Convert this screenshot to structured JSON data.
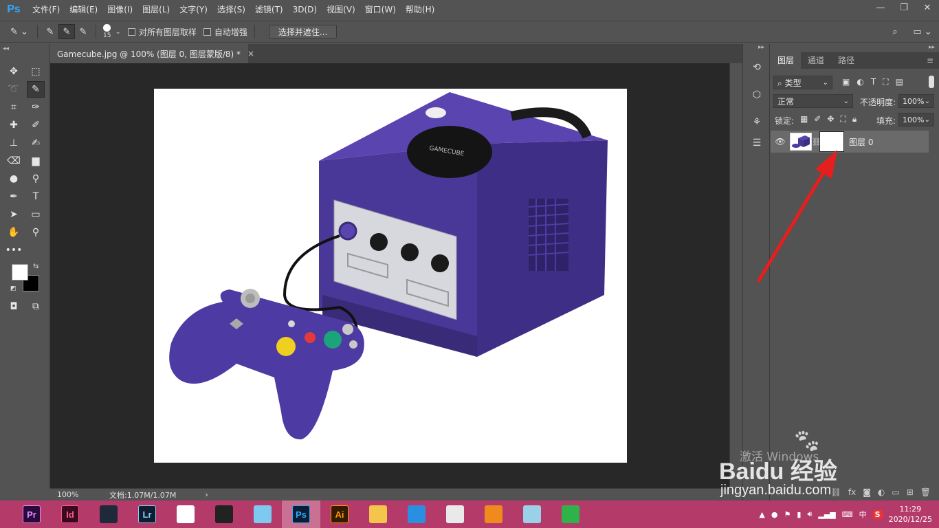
{
  "app": {
    "logo": "Ps",
    "accent": "#31a8ff"
  },
  "menu": [
    "文件(F)",
    "编辑(E)",
    "图像(I)",
    "图层(L)",
    "文字(Y)",
    "选择(S)",
    "滤镜(T)",
    "3D(D)",
    "视图(V)",
    "窗口(W)",
    "帮助(H)"
  ],
  "options": {
    "brush_size": "15",
    "sample_all_layers": "对所有图层取样",
    "auto_enhance": "自动增强",
    "refine_button": "选择并遮住..."
  },
  "document": {
    "tab_title": "Gamecube.jpg @ 100% (图层 0, 图层蒙版/8) *",
    "close": "×",
    "zoom": "100%",
    "doc_info": "文档:1.07M/1.07M",
    "arrow": "›",
    "image_text": "GAMECUBE"
  },
  "layers_panel": {
    "tabs": [
      "图层",
      "通道",
      "路径"
    ],
    "filter_kind": "类型",
    "blend_mode": "正常",
    "opacity_label": "不透明度:",
    "opacity_value": "100%",
    "lock_label": "锁定:",
    "fill_label": "填充:",
    "fill_value": "100%",
    "layer_name": "图层 0"
  },
  "taskbar": {
    "apps": [
      {
        "label": "Pr",
        "bg": "#2a0a3a",
        "fg": "#e48cff"
      },
      {
        "label": "Id",
        "bg": "#3a0a1e",
        "fg": "#ff5a8a"
      },
      {
        "label": "",
        "bg": "#1e2a3a",
        "fg": "#cde"
      },
      {
        "label": "Lr",
        "bg": "#0d1e2d",
        "fg": "#8fc8ff"
      },
      {
        "label": "",
        "bg": "#ffffff",
        "fg": "#c03"
      },
      {
        "label": "",
        "bg": "#222222",
        "fg": "#fff"
      },
      {
        "label": "",
        "bg": "#7ec9f0",
        "fg": "#fff"
      },
      {
        "label": "Ps",
        "bg": "#0a1e33",
        "fg": "#31a8ff"
      },
      {
        "label": "Ai",
        "bg": "#331a00",
        "fg": "#ff9a00"
      },
      {
        "label": "",
        "bg": "#f3c54a",
        "fg": "#fff"
      },
      {
        "label": "",
        "bg": "#2a8fe0",
        "fg": "#fff"
      },
      {
        "label": "",
        "bg": "#e9e9e9",
        "fg": "#fff"
      },
      {
        "label": "",
        "bg": "#f08a1c",
        "fg": "#fff"
      },
      {
        "label": "",
        "bg": "#9ad1e8",
        "fg": "#fff"
      },
      {
        "label": "",
        "bg": "#2fb24a",
        "fg": "#fff"
      }
    ],
    "ime": "中",
    "time": "11:29",
    "date": "2020/12/25"
  },
  "watermark": {
    "activate": "激活 Windows",
    "brand": "Baidu 经验",
    "url": "jingyan.baidu.com"
  }
}
